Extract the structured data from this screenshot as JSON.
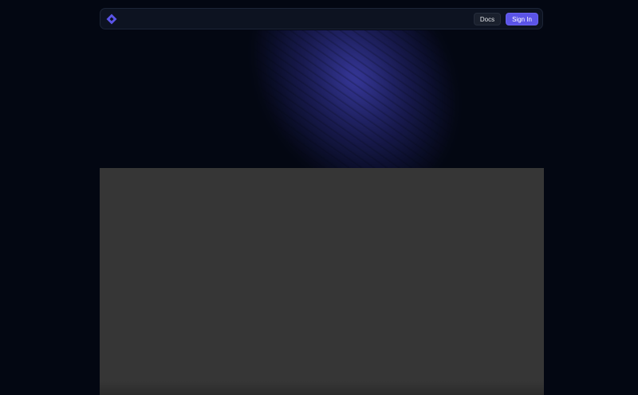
{
  "navbar": {
    "logo_icon": "diamond-logo-icon",
    "accent_color": "#5b54e8",
    "docs_label": "Docs",
    "signin_label": "Sign In"
  },
  "hero": {
    "background_color": "#030712",
    "glow_color": "#4848c8"
  },
  "media_panel": {
    "background_color": "#363636"
  }
}
